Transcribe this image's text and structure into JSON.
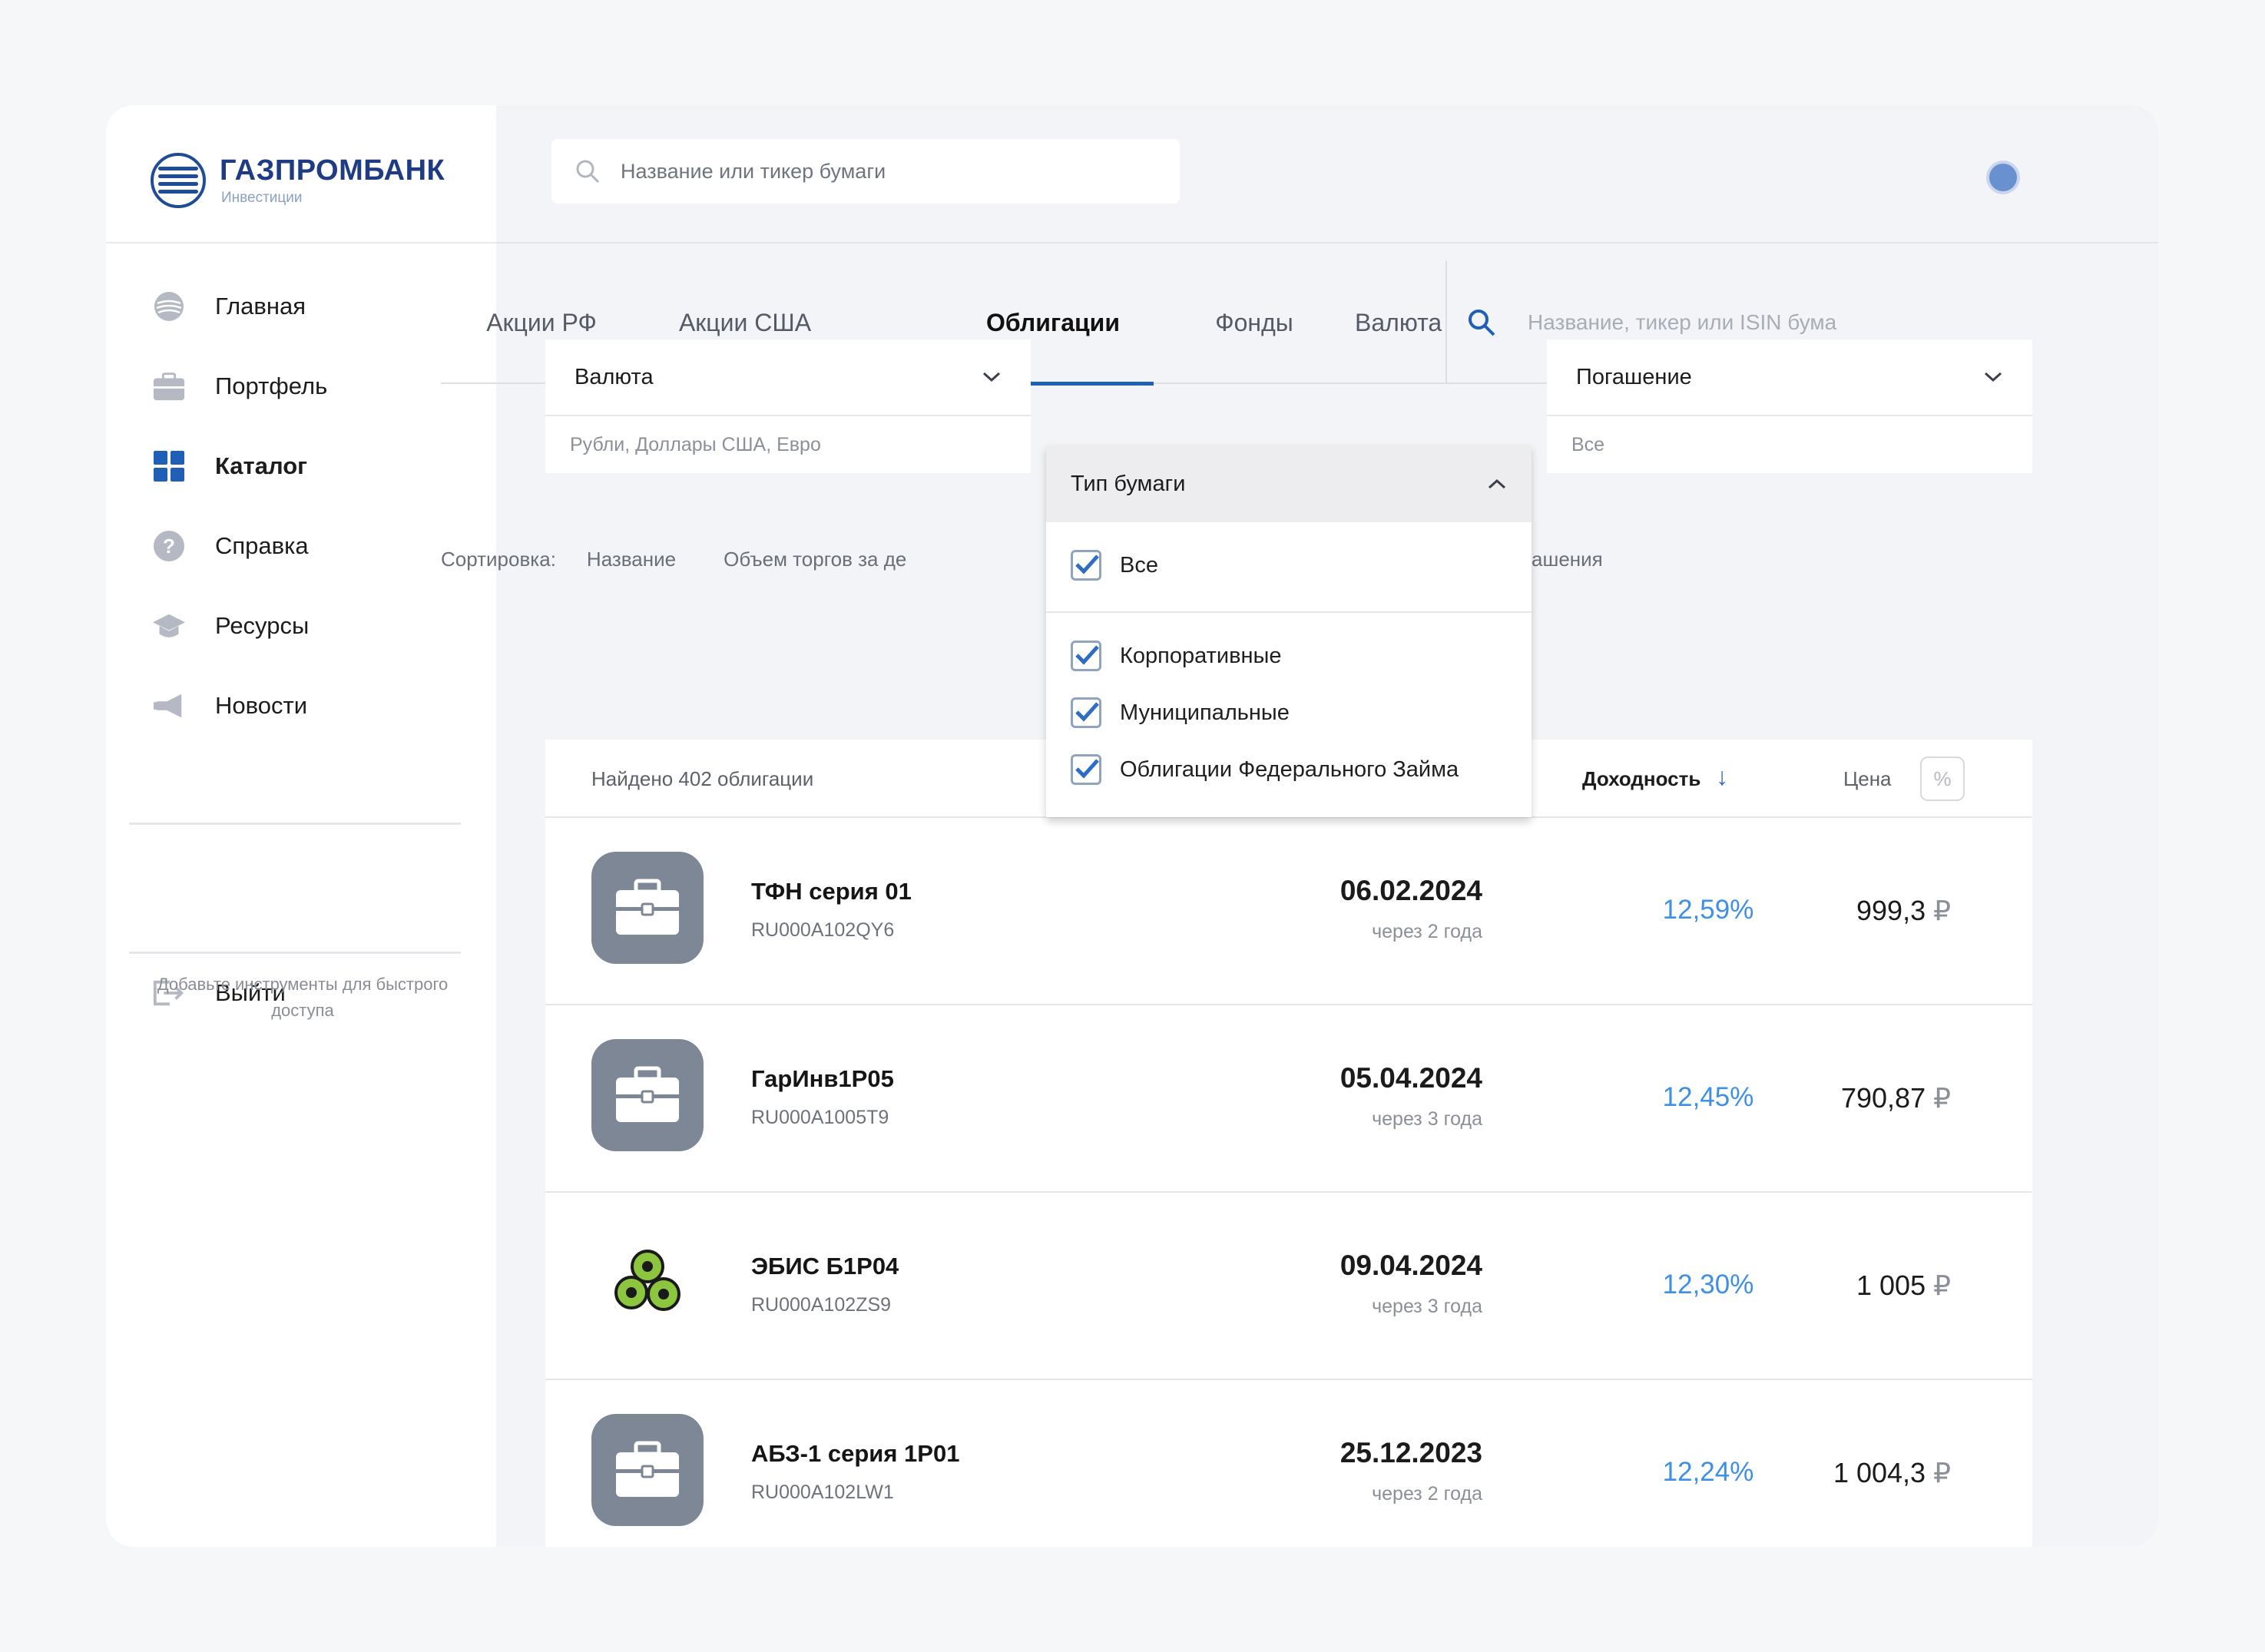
{
  "brand": {
    "name": "ГАЗПРОМБАНК",
    "sub": "Инвестиции"
  },
  "top_search": {
    "placeholder": "Название или тикер бумаги"
  },
  "sidebar": {
    "items": [
      {
        "label": "Главная",
        "icon": "globe-icon"
      },
      {
        "label": "Портфель",
        "icon": "briefcase-icon"
      },
      {
        "label": "Каталог",
        "icon": "grid-icon",
        "active": true
      },
      {
        "label": "Справка",
        "icon": "help-icon"
      },
      {
        "label": "Ресурсы",
        "icon": "graduation-cap-icon"
      },
      {
        "label": "Новости",
        "icon": "megaphone-icon"
      }
    ],
    "logout": "Выйти",
    "hint": "Добавьте инструменты для быстрого доступа"
  },
  "tabs": [
    {
      "label": "Акции РФ"
    },
    {
      "label": "Акции США"
    },
    {
      "label": "Облигации",
      "active": true
    },
    {
      "label": "Фонды"
    },
    {
      "label": "Валюта"
    }
  ],
  "tab_search": {
    "placeholder": "Название, тикер или ISIN бума"
  },
  "filters": {
    "currency": {
      "label": "Валюта",
      "value": "Рубли, Доллары США, Евро"
    },
    "type": {
      "label": "Тип бумаги"
    },
    "maturity": {
      "label": "Погашение",
      "value": "Все"
    }
  },
  "type_dropdown": {
    "all": "Все",
    "options": [
      "Корпоративные",
      "Муниципальные",
      "Облигации Федерального Займа"
    ]
  },
  "sort": {
    "label": "Сортировка:",
    "options": [
      "Название",
      "Объем торгов за де"
    ],
    "tail": "ашения"
  },
  "results": {
    "found": "Найдено 402 облигации",
    "yield_label": "Доходность",
    "price_label": "Цена",
    "pct_toggle": "%",
    "rows": [
      {
        "name": "ТФН серия 01",
        "isin": "RU000A102QY6",
        "date": "06.02.2024",
        "when": "через 2 года",
        "yield": "12,59%",
        "price": "999,3",
        "currency": "₽",
        "logo": "briefcase"
      },
      {
        "name": "ГарИнв1Р05",
        "isin": "RU000A1005T9",
        "date": "05.04.2024",
        "when": "через 3 года",
        "yield": "12,45%",
        "price": "790,87",
        "currency": "₽",
        "logo": "briefcase"
      },
      {
        "name": "ЭБИС Б1Р04",
        "isin": "RU000A102ZS9",
        "date": "09.04.2024",
        "when": "через 3 года",
        "yield": "12,30%",
        "price": "1 005",
        "currency": "₽",
        "logo": "gears"
      },
      {
        "name": "АБЗ-1 серия 1Р01",
        "isin": "RU000A102LW1",
        "date": "25.12.2023",
        "when": "через 2 года",
        "yield": "12,24%",
        "price": "1 004,3",
        "currency": "₽",
        "logo": "briefcase"
      }
    ]
  },
  "colors": {
    "accent": "#1f5fb5",
    "yield": "#3e8fe8",
    "brand": "#1f3b84"
  }
}
